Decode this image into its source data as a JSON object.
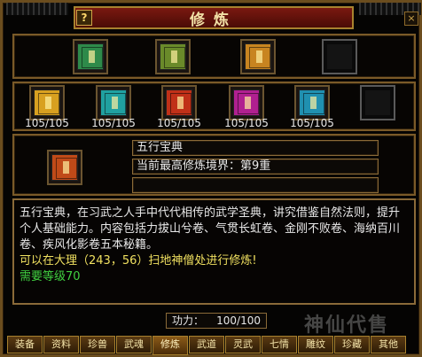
{
  "window": {
    "title": "修炼"
  },
  "titlebar": {
    "help_label": "?",
    "close_label": "×"
  },
  "colors": {
    "frame_gold": "#a8822e",
    "title_red": "#7a1810",
    "text_white": "#e8e8e8",
    "location_yellow": "#f0e060",
    "requirement_green": "#40d040"
  },
  "top_slots": [
    {
      "icon": "scroll-book-icon",
      "color": "#2e8a4a"
    },
    {
      "icon": "bundle-scrolls-icon",
      "color": "#6a8a2a"
    },
    {
      "icon": "treasure-chest-icon",
      "color": "#c88420"
    },
    {
      "icon": "empty-slot",
      "color": ""
    }
  ],
  "books": [
    {
      "icon": "yellow-book-icon",
      "color": "#d8a020",
      "count": "105/105"
    },
    {
      "icon": "cyan-book-icon",
      "color": "#20a0a0",
      "count": "105/105"
    },
    {
      "icon": "red-book-icon",
      "color": "#c03018",
      "count": "105/105"
    },
    {
      "icon": "magenta-book-icon",
      "color": "#b02090",
      "count": "105/105"
    },
    {
      "icon": "teal-book-icon",
      "color": "#2090b0",
      "count": "105/105"
    },
    {
      "icon": "empty-slot",
      "color": "",
      "count": ""
    }
  ],
  "selected": {
    "icon": "five-elements-book-icon",
    "name": "五行宝典",
    "realm": "当前最高修炼境界：第9重",
    "extra": ""
  },
  "description": {
    "body": "五行宝典，在习武之人手中代代相传的武学圣典，讲究借鉴自然法则，提升个人基础能力。内容包括力拔山兮卷、气贯长虹卷、金刚不败卷、海纳百川卷、疾风化影卷五本秘籍。",
    "location": "可以在大理（243，56）扫地神僧处进行修炼!",
    "requirement": "需要等级70"
  },
  "power": {
    "label": "功力：",
    "value": "100/100"
  },
  "tabs": [
    {
      "label": "装备"
    },
    {
      "label": "资料"
    },
    {
      "label": "珍兽"
    },
    {
      "label": "武魂"
    },
    {
      "label": "修炼"
    },
    {
      "label": "武道"
    },
    {
      "label": "灵武"
    },
    {
      "label": "七情"
    },
    {
      "label": "雕纹"
    },
    {
      "label": "珍藏"
    },
    {
      "label": "其他"
    }
  ],
  "active_tab": "修炼",
  "watermark": {
    "text": "神仙代售"
  }
}
